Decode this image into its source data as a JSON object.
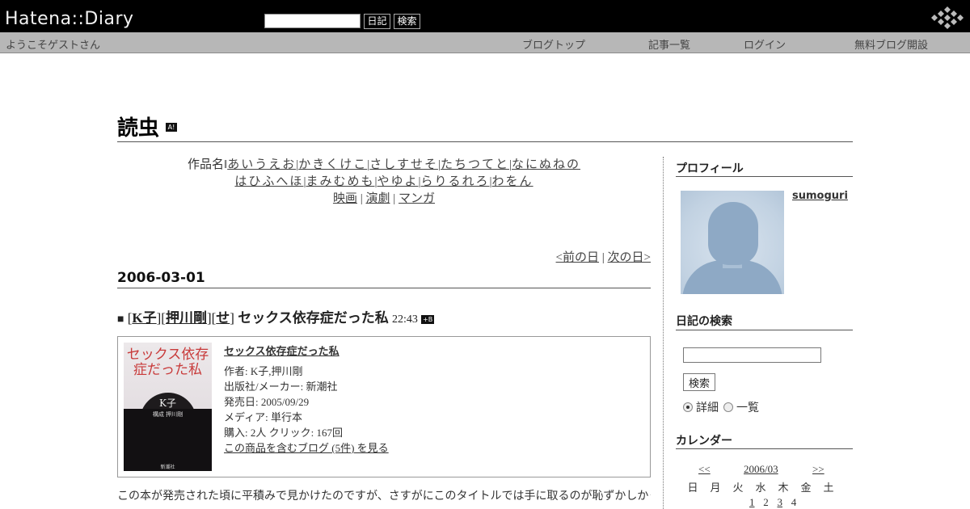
{
  "header": {
    "logo": "Hatena::Diary",
    "search_placeholder": "",
    "diary_button": "日記",
    "search_button": "検索",
    "welcome": "ようこそゲストさん",
    "nav": {
      "blog_top": "ブログトップ",
      "article_list": "記事一覧",
      "login": "ログイン",
      "free_blog": "無料ブログ開設"
    }
  },
  "blog": {
    "title": "読虫",
    "title_icon": "A!"
  },
  "index": {
    "prefix": "作品名‖",
    "rows": [
      [
        "あいうえお",
        "かきくけこ",
        "さしすせそ",
        "たちつてと",
        "なにぬねの"
      ],
      [
        "はひふへほ",
        "まみむめも",
        "やゆよ",
        "らりるれろ",
        "わをん"
      ],
      [
        "映画",
        "演劇",
        "マンガ"
      ]
    ]
  },
  "day_nav": {
    "prev": "<前の日",
    "separator": "|",
    "next": "次の日>"
  },
  "entry": {
    "date": "2006-03-01",
    "bullet": "■",
    "categories": [
      "K子",
      "押川剛",
      "せ"
    ],
    "title": "セックス依存症だった私",
    "time": "22:43",
    "bookmark_icon": "+B",
    "product": {
      "name": "セックス依存症だった私",
      "author": "作者: K子,押川剛",
      "publisher": "出版社/メーカー: 新潮社",
      "release": "発売日: 2005/09/29",
      "media": "メディア: 単行本",
      "stats": "購入: 2人 クリック: 167回",
      "blogs_link": "この商品を含むブログ (5件) を見る",
      "cover_title": "セックス依存症だった私",
      "cover_author": "K子",
      "cover_sub": "構成 押川剛",
      "cover_publisher": "新潮社"
    },
    "body": "この本が発売された頃に平積みで見かけたのですが、さすがにこのタイトルでは手に取るのが恥ずかしかったです。"
  },
  "sidebar": {
    "profile_heading": "プロフィール",
    "username": "sumoguri",
    "search_heading": "日記の検索",
    "search_button": "検索",
    "radio_detail": "詳細",
    "radio_list": "一覧",
    "calendar_heading": "カレンダー",
    "calendar": {
      "prev": "<<",
      "month": "2006/03",
      "next": ">>",
      "weekdays": [
        "日",
        "月",
        "火",
        "水",
        "木",
        "金",
        "土"
      ],
      "row1": [
        "",
        "",
        "",
        "1",
        "2",
        "3",
        "4"
      ]
    }
  }
}
